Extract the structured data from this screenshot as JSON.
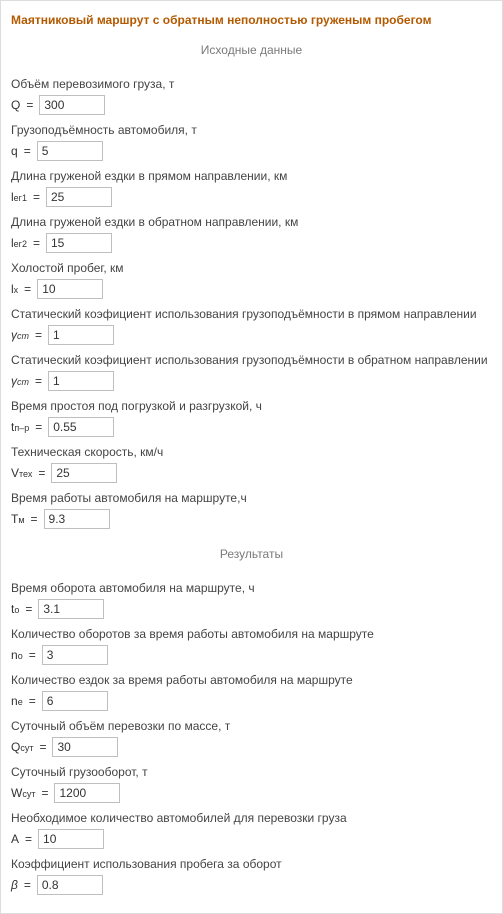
{
  "title": "Маятниковый маршрут с обратным неполностью груженым пробегом",
  "sections": {
    "input_header": "Исходные данные",
    "output_header": "Результаты"
  },
  "inputs": {
    "Q": {
      "label": "Объём перевозимого груза, т",
      "value": "300"
    },
    "q": {
      "label": "Грузоподъёмность автомобиля, т",
      "value": "5"
    },
    "leg1": {
      "label": "Длина груженой ездки в прямом направлении, км",
      "value": "25"
    },
    "leg2": {
      "label": "Длина груженой ездки в обратном направлении, км",
      "value": "15"
    },
    "lx": {
      "label": "Холостой пробег, км",
      "value": "10"
    },
    "gst1": {
      "label": "Статический коэфициент использования грузоподъёмности в прямом направлении",
      "value": "1"
    },
    "gst2": {
      "label": "Статический коэфициент использования грузоподъёмности в обратном направлении",
      "value": "1"
    },
    "tpr": {
      "label": "Время простоя под погрузкой и разгрузкой, ч",
      "value": "0.55"
    },
    "vtex": {
      "label": "Техническая скорость, км/ч",
      "value": "25"
    },
    "Tm": {
      "label": "Время работы автомобиля на маршруте,ч",
      "value": "9.3"
    }
  },
  "outputs": {
    "to": {
      "label": "Время оборота автомобиля на маршруте, ч",
      "value": "3.1"
    },
    "no": {
      "label": "Количество оборотов за время работы автомобиля на маршруте",
      "value": "3"
    },
    "ne": {
      "label": "Количество ездок за время работы автомобиля на маршруте",
      "value": "6"
    },
    "Qsut": {
      "label": "Суточный объём перевозки по массе, т",
      "value": "30"
    },
    "Wsut": {
      "label": "Суточный грузооборот, т",
      "value": "1200"
    },
    "A": {
      "label": "Необходимое количество автомобилей для перевозки груза",
      "value": "10"
    },
    "beta": {
      "label": "Коэффициент использования пробега за оборот",
      "value": "0.8"
    }
  }
}
